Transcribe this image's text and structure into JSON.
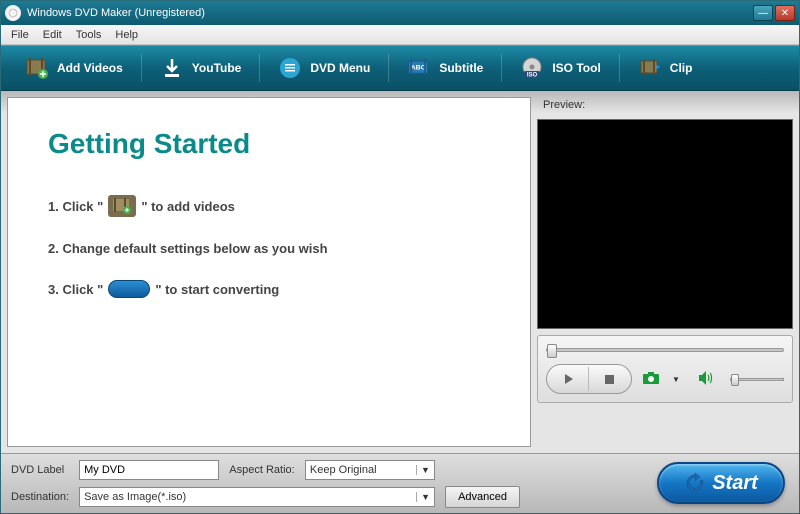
{
  "titlebar": {
    "title": "Windows DVD Maker (Unregistered)"
  },
  "menu": {
    "file": "File",
    "edit": "Edit",
    "tools": "Tools",
    "help": "Help"
  },
  "toolbar": {
    "add_videos": "Add Videos",
    "youtube": "YouTube",
    "dvd_menu": "DVD Menu",
    "subtitle": "Subtitle",
    "iso_tool": "ISO Tool",
    "clip": "Clip"
  },
  "main": {
    "heading": "Getting Started",
    "step1a": "1. Click \"",
    "step1b": "\" to add videos",
    "step2": "2. Change default settings below as you wish",
    "step3a": "3. Click \"",
    "step3b": "\" to start  converting"
  },
  "preview": {
    "label": "Preview:"
  },
  "bottom": {
    "dvd_label_text": "DVD Label",
    "dvd_label_value": "My DVD",
    "aspect_ratio_text": "Aspect Ratio:",
    "aspect_ratio_value": "Keep Original",
    "destination_text": "Destination:",
    "destination_value": "Save as Image(*.iso)",
    "advanced": "Advanced",
    "start": "Start"
  }
}
